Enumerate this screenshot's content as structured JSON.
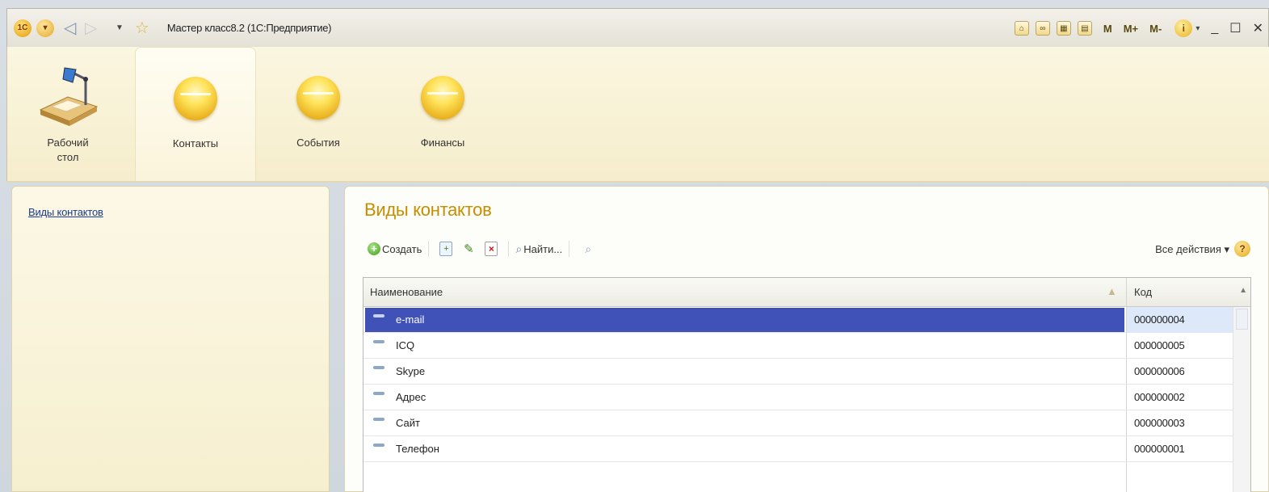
{
  "window": {
    "title": "Мастер класс8.2  (1С:Предприятие)",
    "right_icons": [
      "M",
      "M+",
      "M-"
    ],
    "minimize": "_",
    "maximize": "☐",
    "close": "✕"
  },
  "sections": [
    {
      "label": "Рабочий\nстол",
      "line1": "Рабочий",
      "line2": "стол",
      "icon": "desk-lamp-icon"
    },
    {
      "label": "Контакты",
      "icon": "yellow-sphere-icon"
    },
    {
      "label": "События",
      "icon": "yellow-sphere-icon"
    },
    {
      "label": "Финансы",
      "icon": "yellow-sphere-icon"
    }
  ],
  "nav": {
    "items": [
      "Виды контактов"
    ]
  },
  "form": {
    "title": "Виды контактов",
    "toolbar": {
      "create_label": "Создать",
      "find_label": "Найти...",
      "all_actions_label": "Все действия ▾",
      "help_label": "?"
    },
    "columns": [
      "Наименование",
      "Код"
    ],
    "rows": [
      {
        "name": "e-mail",
        "code": "000000004",
        "selected": true
      },
      {
        "name": "ICQ",
        "code": "000000005"
      },
      {
        "name": "Skype",
        "code": "000000006"
      },
      {
        "name": "Адрес",
        "code": "000000002"
      },
      {
        "name": "Сайт",
        "code": "000000003"
      },
      {
        "name": "Телефон",
        "code": "000000001"
      }
    ]
  },
  "colors": {
    "accent_title": "#c78d00",
    "selection": "#4052b8",
    "panel_bg": "#f6efcf"
  }
}
